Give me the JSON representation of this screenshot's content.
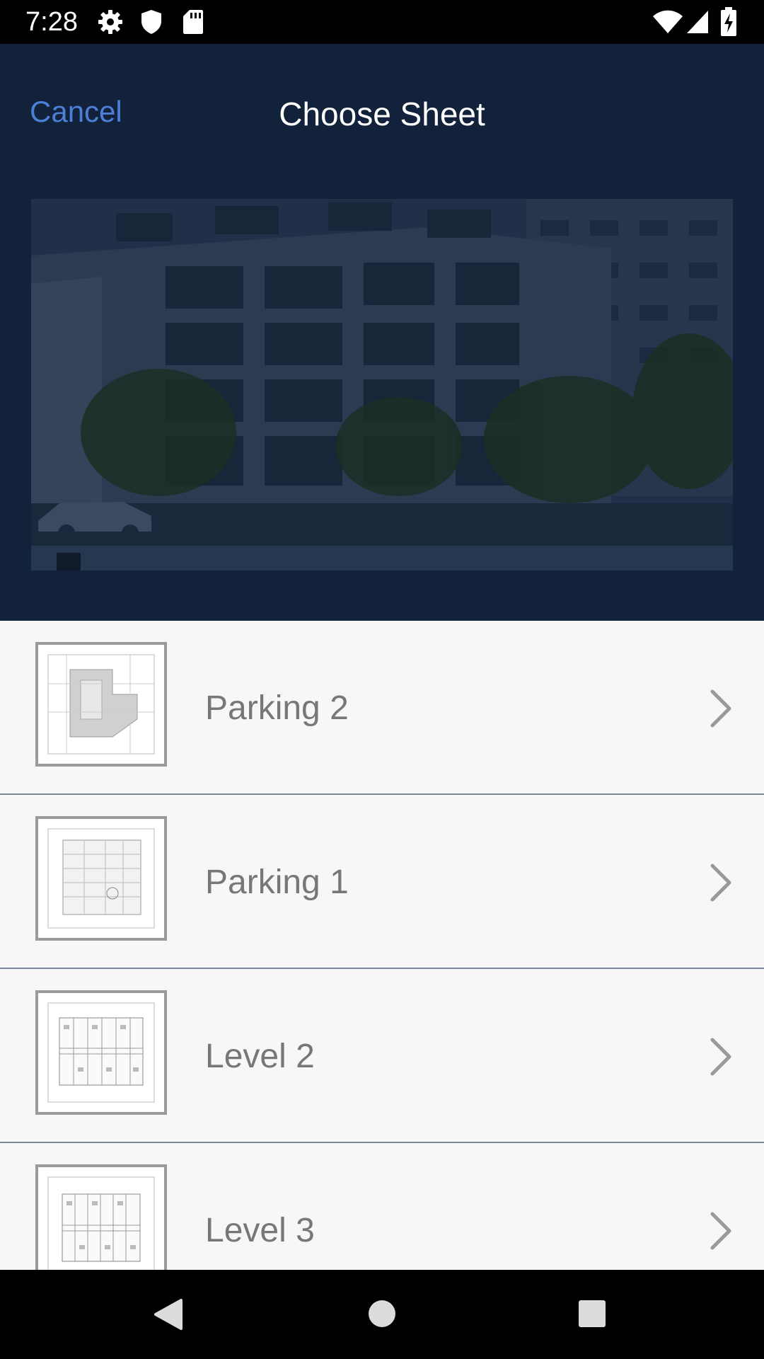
{
  "status_bar": {
    "time": "7:28",
    "icons_left": [
      "gear-icon",
      "shield-icon",
      "sd-card-icon"
    ],
    "icons_right": [
      "wifi-icon",
      "cell-signal-icon",
      "battery-charging-icon"
    ]
  },
  "header": {
    "cancel_label": "Cancel",
    "title": "Choose Sheet",
    "background_color": "#11223a",
    "accent_color": "#4c7fd6"
  },
  "sheets": [
    {
      "label": "Parking 2",
      "thumbnail": "parking-2-plan"
    },
    {
      "label": "Parking 1",
      "thumbnail": "parking-1-plan"
    },
    {
      "label": "Level 2",
      "thumbnail": "level-2-plan"
    },
    {
      "label": "Level 3",
      "thumbnail": "level-3-plan"
    }
  ],
  "nav_bar": {
    "icons": [
      "back-icon",
      "home-icon",
      "recents-icon"
    ]
  }
}
